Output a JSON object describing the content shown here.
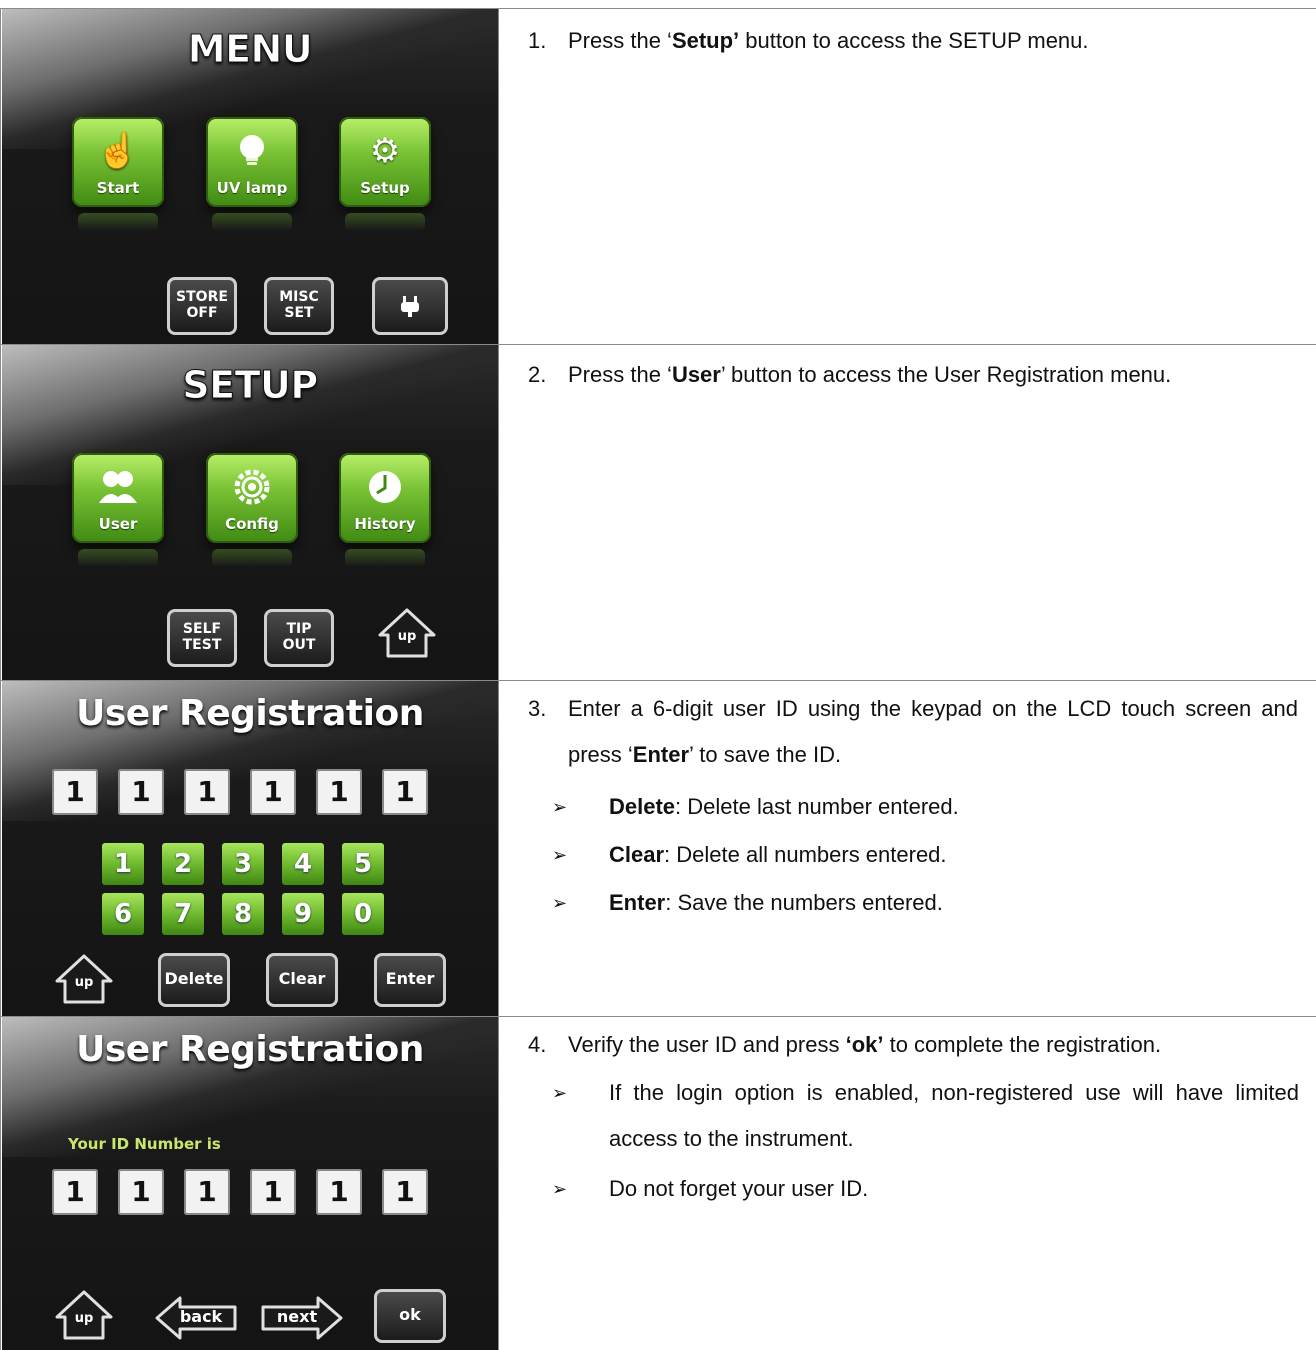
{
  "rows": [
    {
      "screen": {
        "title": "MENU",
        "buttons": [
          {
            "label": "Start",
            "icon": "hand-pointer-icon"
          },
          {
            "label": "UV lamp",
            "icon": "light-bulb-icon"
          },
          {
            "label": "Setup",
            "icon": "gears-icon"
          }
        ],
        "bottom": [
          {
            "line1": "STORE",
            "line2": "OFF"
          },
          {
            "line1": "MISC",
            "line2": "SET"
          },
          {
            "icon": "power-plug-icon"
          }
        ]
      },
      "step_number": "1.",
      "text_parts": [
        "Press the ‘",
        "Setup’",
        " button to access the SETUP menu."
      ]
    },
    {
      "screen": {
        "title": "SETUP",
        "buttons": [
          {
            "label": "User",
            "icon": "users-icon"
          },
          {
            "label": "Config",
            "icon": "gear-icon"
          },
          {
            "label": "History",
            "icon": "clock-icon"
          }
        ],
        "bottom": [
          {
            "line1": "SELF",
            "line2": "TEST"
          },
          {
            "line1": "TIP",
            "line2": "OUT"
          },
          {
            "label": "up",
            "icon": "home-up-icon"
          }
        ]
      },
      "step_number": "2.",
      "text_parts": [
        "Press the ‘",
        "User",
        "’ button to access the User Registration menu."
      ]
    },
    {
      "screen": {
        "title": "User Registration",
        "digits": [
          "1",
          "1",
          "1",
          "1",
          "1",
          "1"
        ],
        "keys_row1": [
          "1",
          "2",
          "3",
          "4",
          "5"
        ],
        "keys_row2": [
          "6",
          "7",
          "8",
          "9",
          "0"
        ],
        "up_label": "up",
        "buttons": [
          "Delete",
          "Clear",
          "Enter"
        ]
      },
      "step_number": "3.",
      "text_parts": [
        "Enter a 6-digit user ID using the keypad on the LCD touch screen and press ‘",
        "Enter",
        "’ to save the ID."
      ],
      "bullets": [
        {
          "term": "Delete",
          "desc": ": Delete last number entered."
        },
        {
          "term": "Clear",
          "desc": ": Delete all numbers entered."
        },
        {
          "term": "Enter",
          "desc": ": Save the numbers entered."
        }
      ],
      "bullet_marker": "➢"
    },
    {
      "screen": {
        "title": "User Registration",
        "id_label": "Your ID Number is",
        "digits": [
          "1",
          "1",
          "1",
          "1",
          "1",
          "1"
        ],
        "up_label": "up",
        "back_label": "back",
        "next_label": "next",
        "ok_label": "ok"
      },
      "step_number": "4.",
      "text_parts": [
        "Verify the user ID and press ",
        "‘ok’",
        " to complete the registration."
      ],
      "bullets": [
        {
          "desc": "If the login option is enabled, non-registered use will have limited access to the instrument."
        },
        {
          "desc": "Do not forget your user ID."
        }
      ],
      "bullet_marker": "➢"
    }
  ]
}
